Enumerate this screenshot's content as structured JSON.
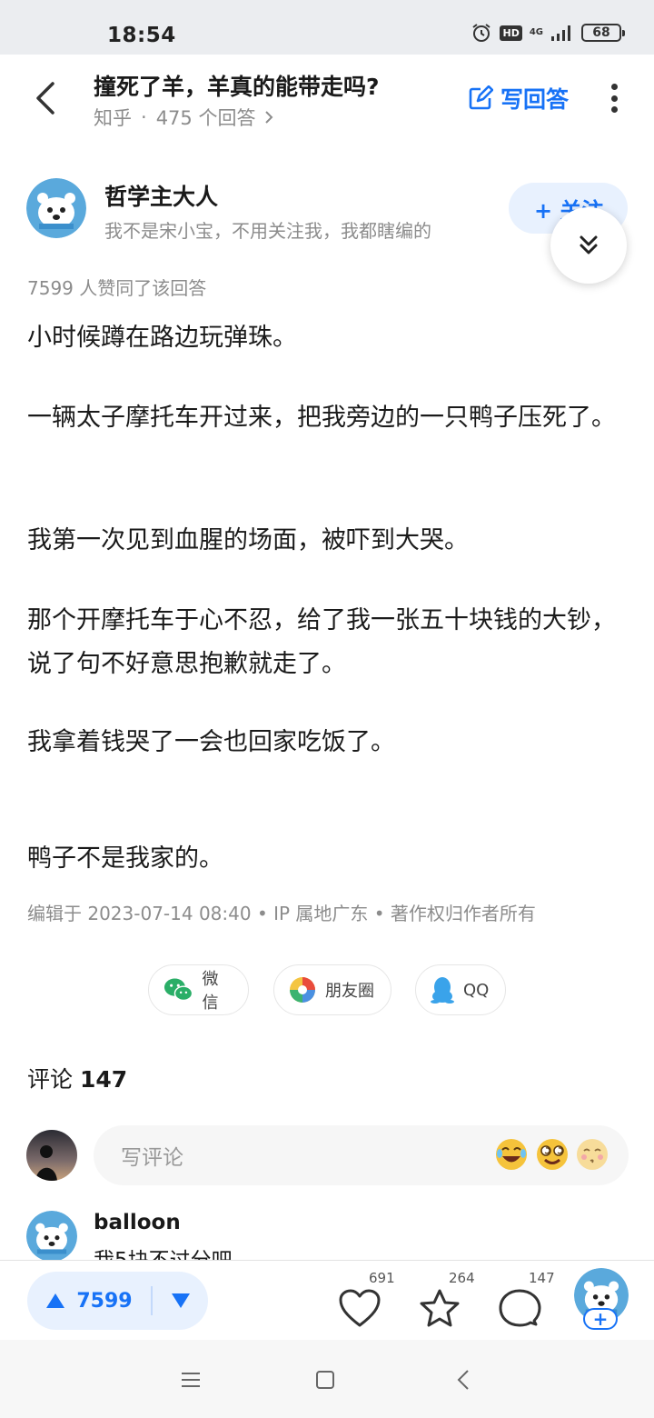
{
  "status_bar": {
    "time": "18:54",
    "hd": "HD",
    "network": "4G",
    "battery": "68"
  },
  "header": {
    "title": "撞死了羊，羊真的能带走吗?",
    "source": "知乎",
    "separator": "·",
    "answers": "475 个回答",
    "write_answer": "写回答"
  },
  "author": {
    "name": "哲学主大人",
    "bio": "我不是宋小宝，不用关注我，我都瞎编的",
    "follow": "+ 关注"
  },
  "answer": {
    "likes_line": "7599 人赞同了该回答",
    "paragraphs": [
      "小时候蹲在路边玩弹珠。",
      "一辆太子摩托车开过来，把我旁边的一只鸭子压死了。",
      "我第一次见到血腥的场面，被吓到大哭。",
      "那个开摩托车于心不忍，给了我一张五十块钱的大钞，说了句不好意思抱歉就走了。",
      "我拿着钱哭了一会也回家吃饭了。",
      "鸭子不是我家的。"
    ],
    "meta": "编辑于 2023-07-14 08:40 • IP 属地广东 • 著作权归作者所有"
  },
  "share": {
    "wechat": "微信",
    "moments": "朋友圈",
    "qq": "QQ"
  },
  "comments": {
    "label": "评论",
    "count": "147",
    "input_placeholder": "写评论",
    "first": {
      "user": "balloon",
      "text": "我5块不过分吧"
    }
  },
  "bottom_bar": {
    "vote_count": "7599",
    "like_count": "691",
    "fav_count": "264",
    "comment_count": "147",
    "accent": "#1772f6"
  }
}
